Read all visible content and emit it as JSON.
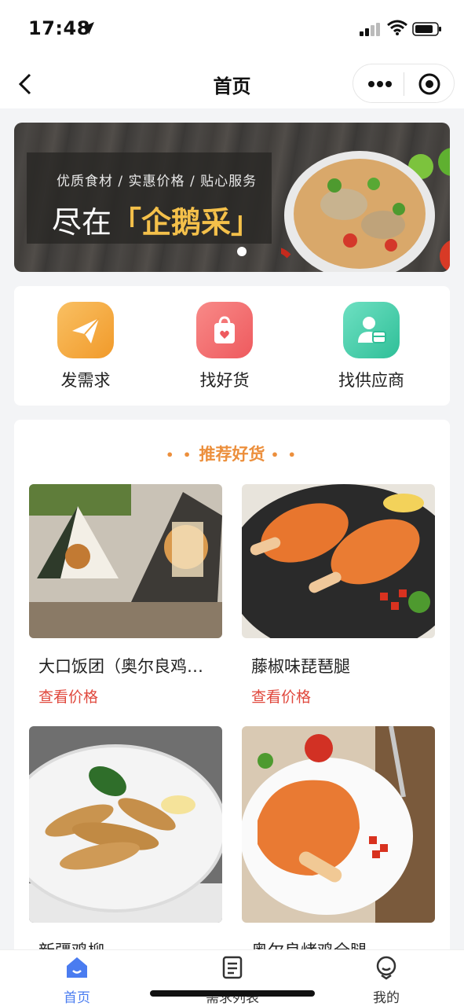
{
  "status_bar": {
    "time": "17:48"
  },
  "nav": {
    "title": "首页"
  },
  "banner": {
    "tagline": "优质食材 / 实惠价格 / 贴心服务",
    "headline_prefix": "尽在",
    "headline_brand": "「企鹅采」"
  },
  "quick_actions": [
    {
      "label": "发需求",
      "icon": "paper-plane-icon"
    },
    {
      "label": "找好货",
      "icon": "shopping-bag-icon"
    },
    {
      "label": "找供应商",
      "icon": "supplier-icon"
    }
  ],
  "recommended": {
    "title": "推荐好货",
    "products": [
      {
        "name": "大口饭团（奥尔良鸡…",
        "price_label": "查看价格"
      },
      {
        "name": "藤椒味琵琶腿",
        "price_label": "查看价格"
      },
      {
        "name": "新疆鸡柳",
        "price_label": ""
      },
      {
        "name": "奥尔良烤鸡全腿",
        "price_label": ""
      }
    ]
  },
  "tabbar": [
    {
      "label": "首页",
      "icon": "home-icon",
      "active": true
    },
    {
      "label": "需求列表",
      "icon": "list-icon",
      "active": false
    },
    {
      "label": "我的",
      "icon": "profile-icon",
      "active": false
    }
  ],
  "colors": {
    "accent": "#4a7cf0",
    "price": "#e0483d",
    "section_title": "#ec8f3c"
  }
}
